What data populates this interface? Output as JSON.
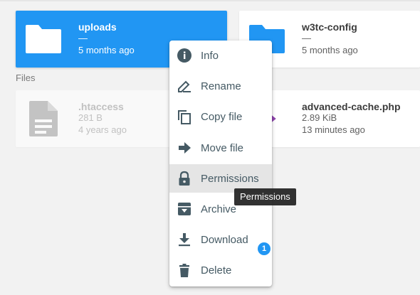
{
  "folders": [
    {
      "name": "uploads",
      "separator": "—",
      "modified": "5 months ago",
      "selected": true
    },
    {
      "name": "w3tc-config",
      "separator": "—",
      "modified": "5 months ago",
      "selected": false
    }
  ],
  "files_section_label": "Files",
  "files": [
    {
      "name": ".htaccess",
      "size": "281 B",
      "modified": "4 years ago",
      "icon": "document-icon"
    },
    {
      "name": "advanced-cache.php",
      "size": "2.89 KiB",
      "modified": "13 minutes ago",
      "icon": "code-icon"
    }
  ],
  "context_menu": {
    "items": [
      {
        "label": "Info",
        "icon": "info-icon"
      },
      {
        "label": "Rename",
        "icon": "pencil-icon"
      },
      {
        "label": "Copy file",
        "icon": "copy-icon"
      },
      {
        "label": "Move file",
        "icon": "arrow-right-icon"
      },
      {
        "label": "Permissions",
        "icon": "lock-icon",
        "hovered": true
      },
      {
        "label": "Archive",
        "icon": "archive-icon"
      },
      {
        "label": "Download",
        "icon": "download-icon"
      },
      {
        "label": "Delete",
        "icon": "trash-icon"
      }
    ]
  },
  "tooltip": "Permissions",
  "badge_count": "1",
  "colors": {
    "accent": "#2196f3",
    "menu_text": "#455a64",
    "php_icon": "#8e44ad"
  }
}
